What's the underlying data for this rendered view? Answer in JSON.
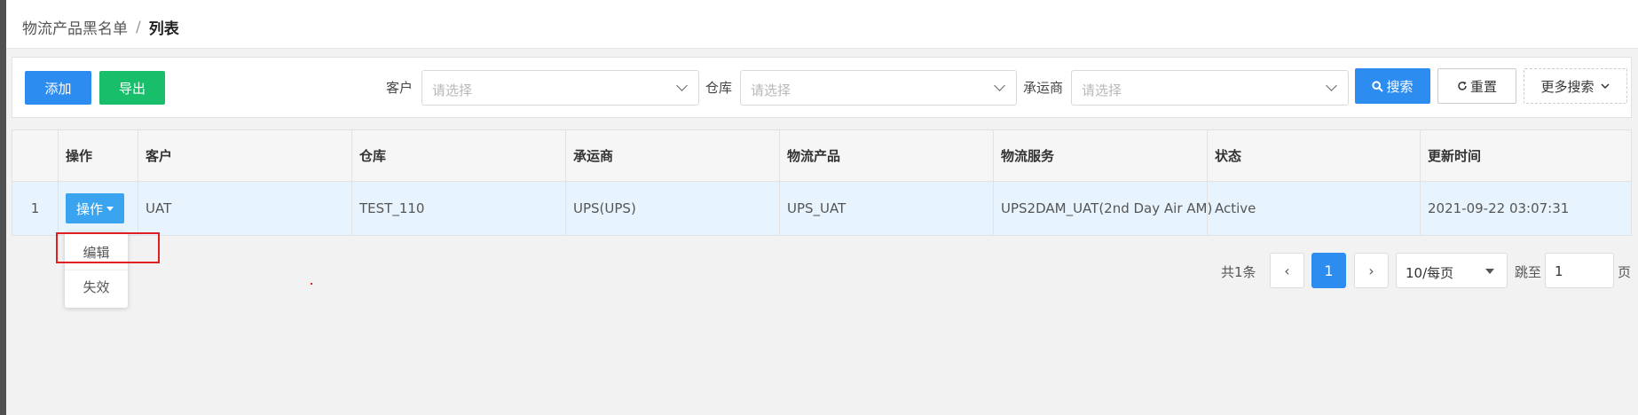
{
  "breadcrumb": {
    "parent": "物流产品黑名单",
    "separator": "/",
    "current": "列表"
  },
  "toolbar": {
    "add_label": "添加",
    "export_label": "导出",
    "customer_label": "客户",
    "customer_placeholder": "请选择",
    "warehouse_label": "仓库",
    "warehouse_placeholder": "请选择",
    "carrier_label": "承运商",
    "carrier_placeholder": "请选择",
    "search_label": "搜索",
    "reset_label": "重置",
    "more_search_label": "更多搜索"
  },
  "table": {
    "columns": [
      "",
      "操作",
      "客户",
      "仓库",
      "承运商",
      "物流产品",
      "物流服务",
      "状态",
      "更新时间"
    ],
    "rows": [
      {
        "index": "1",
        "action": "操作",
        "customer": "UAT",
        "warehouse": "TEST_110",
        "carrier": "UPS(UPS)",
        "product": "UPS_UAT",
        "service": "UPS2DAM_UAT(2nd Day Air AM)",
        "status": "Active",
        "updated": "2021-09-22 03:07:31"
      }
    ]
  },
  "dropdown": {
    "items": [
      "编辑",
      "失效"
    ]
  },
  "pagination": {
    "total": "共1条",
    "prev": "‹",
    "current_page": "1",
    "next": "›",
    "page_size": "10/每页",
    "jump_label": "跳至",
    "jump_value": "1",
    "page_suffix": "页"
  },
  "colors": {
    "primary": "#2d8cf0",
    "success": "#19be6b",
    "highlight": "#e02020",
    "row_selected": "#e8f4fd"
  }
}
